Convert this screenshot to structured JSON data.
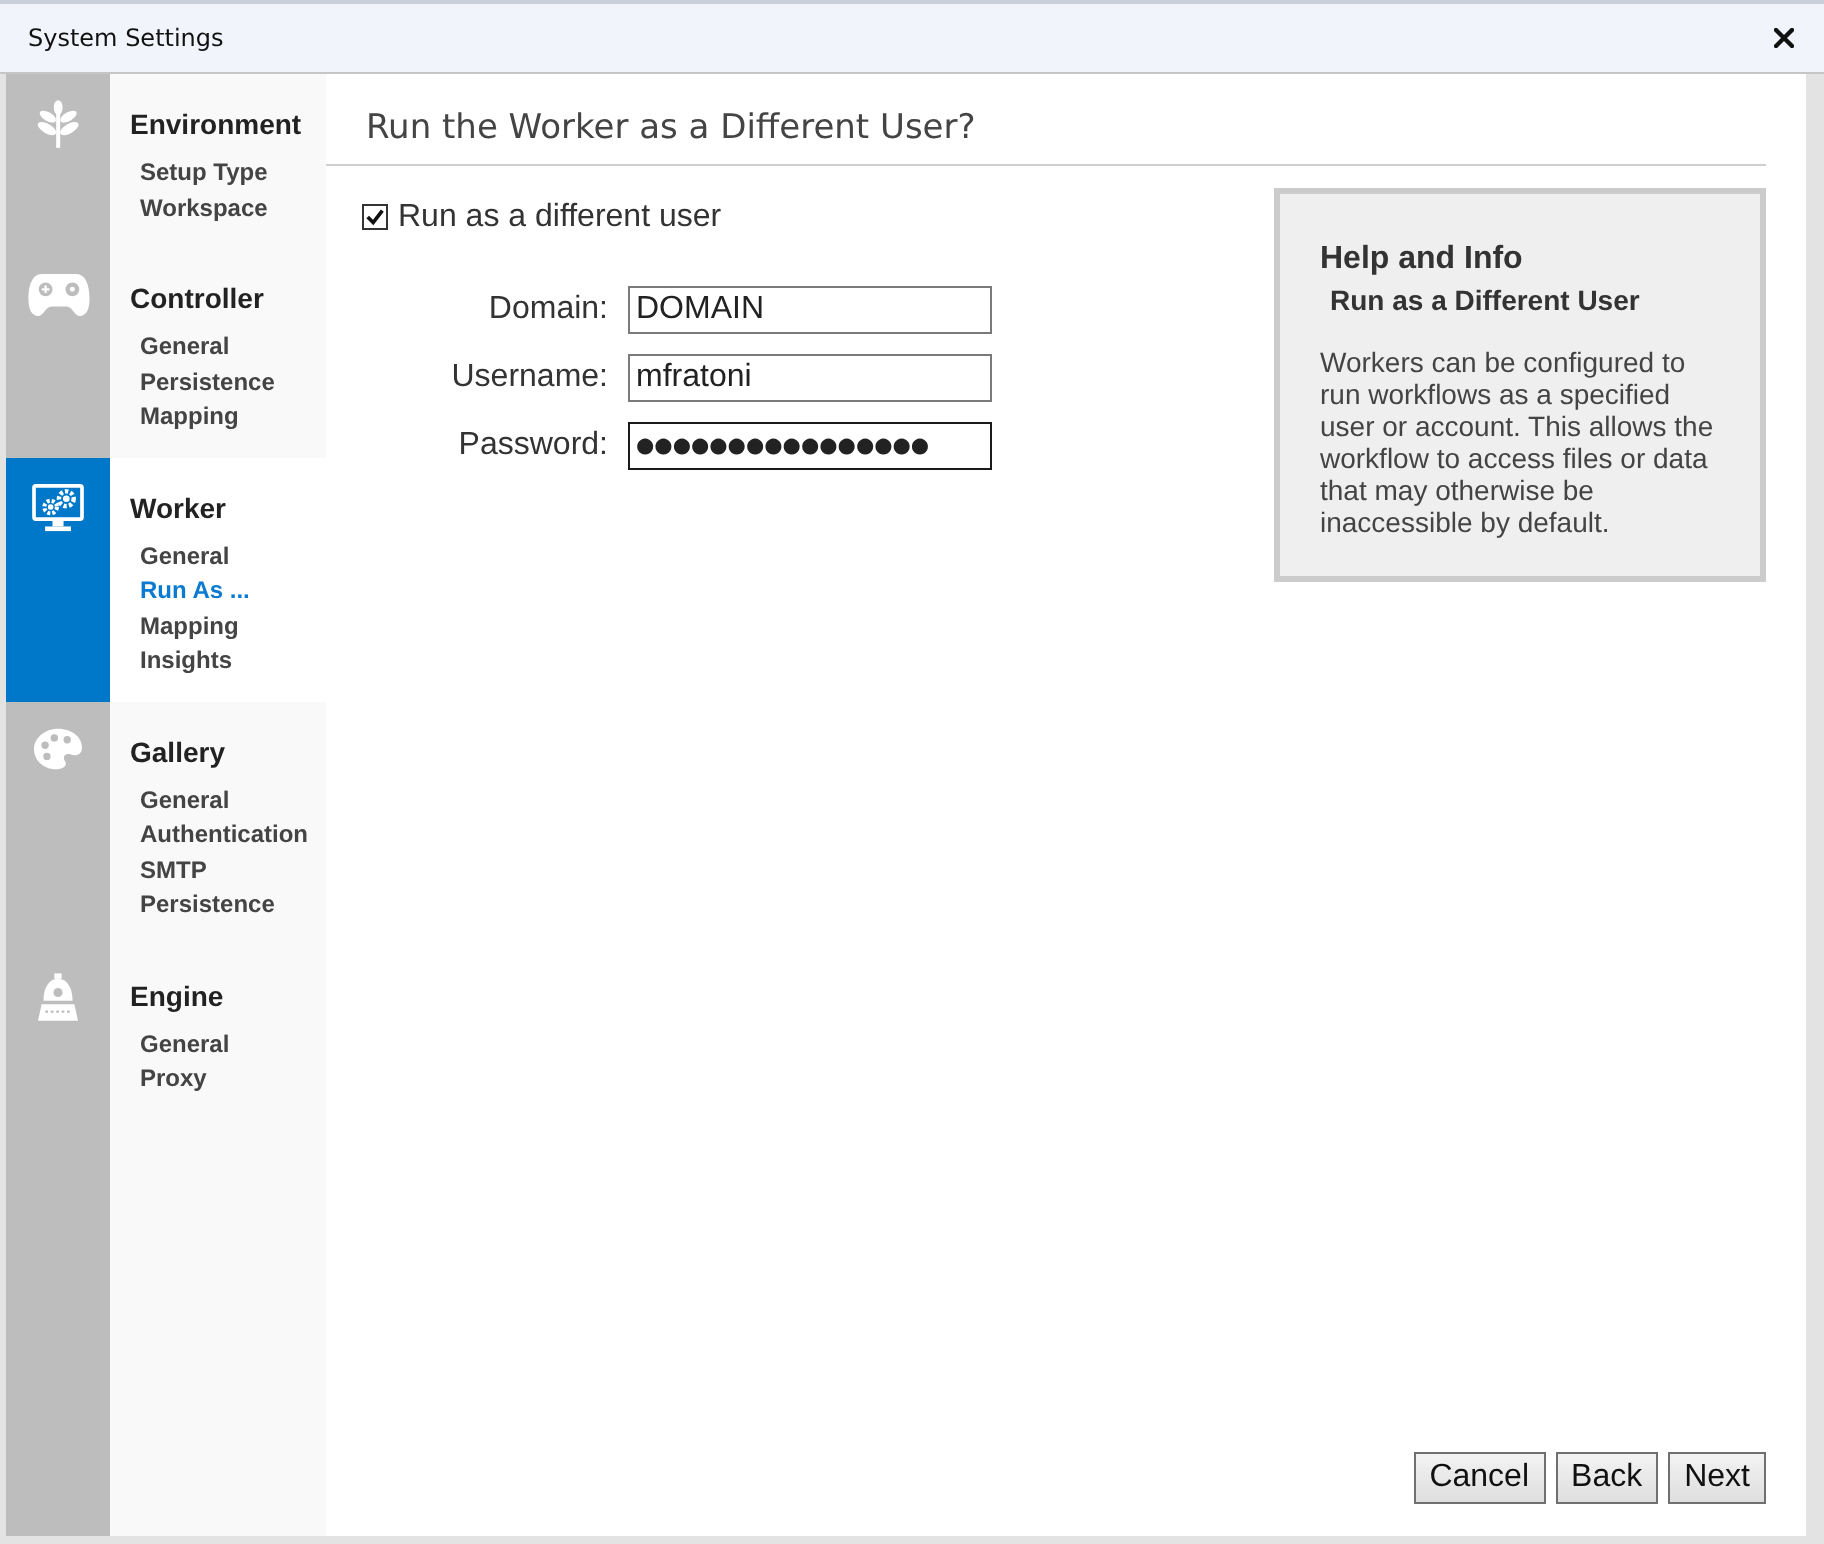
{
  "window": {
    "title": "System Settings"
  },
  "sidebar": {
    "sections": [
      {
        "title": "Environment",
        "selected": false,
        "items": [
          {
            "label": "Setup Type",
            "selected": false
          },
          {
            "label": "Workspace",
            "selected": false
          }
        ]
      },
      {
        "title": "Controller",
        "selected": false,
        "items": [
          {
            "label": "General",
            "selected": false
          },
          {
            "label": "Persistence",
            "selected": false
          },
          {
            "label": "Mapping",
            "selected": false
          }
        ]
      },
      {
        "title": "Worker",
        "selected": true,
        "items": [
          {
            "label": "General",
            "selected": false
          },
          {
            "label": "Run As ...",
            "selected": true
          },
          {
            "label": "Mapping",
            "selected": false
          },
          {
            "label": "Insights",
            "selected": false
          }
        ]
      },
      {
        "title": "Gallery",
        "selected": false,
        "items": [
          {
            "label": "General",
            "selected": false
          },
          {
            "label": "Authentication",
            "selected": false
          },
          {
            "label": "SMTP",
            "selected": false
          },
          {
            "label": "Persistence",
            "selected": false
          }
        ]
      },
      {
        "title": "Engine",
        "selected": false,
        "items": [
          {
            "label": "General",
            "selected": false
          },
          {
            "label": "Proxy",
            "selected": false
          }
        ]
      }
    ]
  },
  "main": {
    "title": "Run the Worker as a Different User?",
    "checkbox": {
      "label": "Run as a different user",
      "checked": true
    },
    "fields": [
      {
        "kind": "text",
        "label": "Domain:",
        "value": "DOMAIN",
        "focused": false
      },
      {
        "kind": "text",
        "label": "Username:",
        "value": "mfratoni",
        "focused": false
      },
      {
        "kind": "password",
        "label": "Password:",
        "value": "●●●●●●●●●●●●●●●●",
        "focused": true
      }
    ]
  },
  "help": {
    "title": "Help and Info",
    "subtitle": "Run as a Different User",
    "text": "Workers can be configured to run workflows as a specified user or account. This allows the workflow to access files or data that may otherwise be inaccessible by default."
  },
  "buttons": [
    "Cancel",
    "Back",
    "Next"
  ]
}
